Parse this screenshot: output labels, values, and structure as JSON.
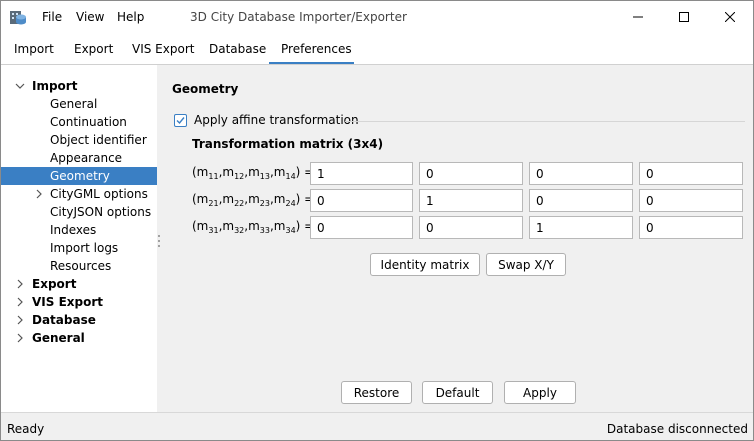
{
  "menu": {
    "file": "File",
    "view": "View",
    "help": "Help"
  },
  "title": "3D City Database Importer/Exporter",
  "tabs": [
    "Import",
    "Export",
    "VIS Export",
    "Database",
    "Preferences"
  ],
  "sidebar": {
    "import": "Import",
    "import_children": [
      "General",
      "Continuation",
      "Object identifier",
      "Appearance",
      "Geometry",
      "CityGML options",
      "CityJSON options",
      "Indexes",
      "Import logs",
      "Resources"
    ],
    "export": "Export",
    "vis_export": "VIS Export",
    "database": "Database",
    "general": "General"
  },
  "content": {
    "section_title": "Geometry",
    "checkbox_label": "Apply affine transformation",
    "checkbox_checked": true,
    "matrix_title": "Transformation matrix (3x4)",
    "rows": [
      {
        "label_prefix": "(m",
        "subs": [
          "11",
          "12",
          "13",
          "14"
        ],
        "values": [
          "1",
          "0",
          "0",
          "0"
        ]
      },
      {
        "label_prefix": "(m",
        "subs": [
          "21",
          "22",
          "23",
          "24"
        ],
        "values": [
          "0",
          "1",
          "0",
          "0"
        ]
      },
      {
        "label_prefix": "(m",
        "subs": [
          "31",
          "32",
          "33",
          "34"
        ],
        "values": [
          "0",
          "0",
          "1",
          "0"
        ]
      }
    ],
    "identity_button": "Identity matrix",
    "swap_button": "Swap X/Y",
    "restore_button": "Restore",
    "default_button": "Default",
    "apply_button": "Apply"
  },
  "status": {
    "left": "Ready",
    "right": "Database disconnected"
  },
  "colors": {
    "accent": "#3a7fc4",
    "selection": "#3a7fc4"
  }
}
